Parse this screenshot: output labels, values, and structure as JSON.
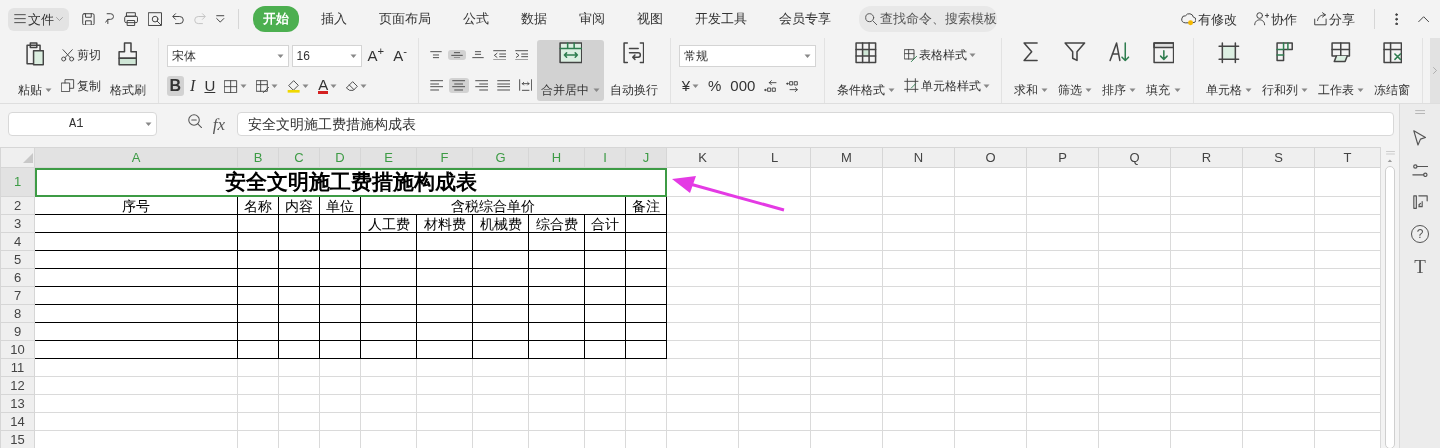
{
  "title_bar": {
    "file_menu": {
      "label": "文件"
    },
    "quick_access": [
      {
        "kind": "save",
        "disabled": false
      },
      {
        "kind": "hook",
        "disabled": false
      },
      {
        "kind": "print",
        "disabled": false
      },
      {
        "kind": "preview",
        "disabled": false
      },
      {
        "kind": "undo",
        "disabled": false
      },
      {
        "kind": "redo",
        "disabled": true
      },
      {
        "kind": "more",
        "disabled": false
      }
    ],
    "menu_tabs": [
      {
        "label": "开始",
        "selected": true
      },
      {
        "label": "插入",
        "selected": false
      },
      {
        "label": "页面布局",
        "selected": false
      },
      {
        "label": "公式",
        "selected": false
      },
      {
        "label": "数据",
        "selected": false
      },
      {
        "label": "审阅",
        "selected": false
      },
      {
        "label": "视图",
        "selected": false
      },
      {
        "label": "开发工具",
        "selected": false
      },
      {
        "label": "会员专享",
        "selected": false
      }
    ],
    "search": {
      "placeholder": "查找命令、搜索模板"
    },
    "actions": [
      {
        "kind": "cloud",
        "label": "有修改"
      },
      {
        "kind": "person",
        "label": "协作"
      },
      {
        "kind": "share",
        "label": "分享"
      }
    ]
  },
  "ribbon": [
    {
      "columns": [
        {
          "large": {
            "kind": "clipboard",
            "label": "粘贴",
            "dropdown": true
          }
        },
        {
          "lines": [
            {
              "items": [
                {
                  "kind": "scissors",
                  "label": "剪切"
                }
              ]
            },
            {
              "items": [
                {
                  "kind": "copy",
                  "label": "复制"
                }
              ]
            }
          ]
        },
        {
          "large": {
            "kind": "brush",
            "label": "格式刷"
          }
        }
      ]
    },
    {
      "columns": [
        {
          "lines": [
            {
              "items": [
                {
                  "kind": "font-select",
                  "value": "宋体"
                },
                {
                  "kind": "size-select",
                  "value": "16"
                },
                {
                  "kind": "text",
                  "label": "A$^{+}$"
                },
                {
                  "kind": "text",
                  "label": "A$^{-}$"
                }
              ]
            },
            {
              "items": [
                {
                  "kind": "bold",
                  "label": "B",
                  "selected": true
                },
                {
                  "kind": "italic",
                  "label": "I",
                  "selected": false
                },
                {
                  "kind": "underline",
                  "label": "U",
                  "selected": false
                },
                {
                  "kind": "borders",
                  "dropdown": true
                },
                {
                  "kind": "cell-style",
                  "dropdown": true
                },
                {
                  "kind": "fill",
                  "dropdown": true
                },
                {
                  "kind": "font-color",
                  "label": "A",
                  "dropdown": true
                },
                {
                  "kind": "eraser",
                  "dropdown": true
                }
              ]
            }
          ]
        }
      ]
    },
    {
      "columns": [
        {
          "lines": [
            {
              "items": [
                {
                  "kind": "align-top",
                  "selected": false
                },
                {
                  "kind": "align-middle",
                  "selected": true
                },
                {
                  "kind": "align-bottom",
                  "selected": false
                },
                {
                  "kind": "indent-less",
                  "selected": false
                },
                {
                  "kind": "indent-more",
                  "selected": false
                }
              ]
            },
            {
              "items": [
                {
                  "kind": "align-left",
                  "selected": false
                },
                {
                  "kind": "align-center",
                  "selected": true
                },
                {
                  "kind": "align-right",
                  "selected": false
                },
                {
                  "kind": "justify",
                  "selected": false
                },
                {
                  "kind": "distribute",
                  "selected": false
                }
              ]
            }
          ]
        },
        {
          "large": {
            "kind": "merge",
            "label": "合并居中",
            "dropdown": true,
            "selected": true
          }
        },
        {
          "large": {
            "kind": "wrap",
            "label": "自动换行",
            "selected": false
          }
        }
      ]
    },
    {
      "columns": [
        {
          "lines": [
            {
              "items": [
                {
                  "kind": "format-select",
                  "value": "常规"
                }
              ]
            },
            {
              "items": [
                {
                  "kind": "text",
                  "label": "¥",
                  "dropdown": true
                },
                {
                  "kind": "text",
                  "label": "%"
                },
                {
                  "kind": "text",
                  "label": "000"
                },
                {
                  "kind": "decimal-more"
                },
                {
                  "kind": "decimal-less"
                }
              ]
            }
          ]
        }
      ]
    },
    {
      "columns": [
        {
          "large": {
            "kind": "grid-cond",
            "label": "条件格式",
            "dropdown": true
          }
        },
        {
          "lines": [
            {
              "items": [
                {
                  "kind": "table-style",
                  "label": "表格样式",
                  "dropdown": true
                }
              ]
            },
            {
              "items": [
                {
                  "kind": "cell-format",
                  "label": "单元格样式",
                  "dropdown": true
                }
              ]
            }
          ]
        }
      ]
    },
    {
      "columns": [
        {
          "large": {
            "kind": "sum",
            "label": "求和",
            "dropdown": true
          }
        },
        {
          "large": {
            "kind": "filter",
            "label": "筛选",
            "dropdown": true
          }
        },
        {
          "large": {
            "kind": "sort",
            "label": "排序",
            "dropdown": true
          }
        },
        {
          "large": {
            "kind": "fill-down",
            "label": "填充",
            "dropdown": true
          }
        }
      ]
    },
    {
      "columns": [
        {
          "large": {
            "kind": "cells",
            "label": "单元格",
            "dropdown": true
          }
        },
        {
          "large": {
            "kind": "rows-cols",
            "label": "行和列",
            "dropdown": true
          }
        },
        {
          "large": {
            "kind": "sheet",
            "label": "工作表",
            "dropdown": true
          }
        },
        {
          "large": {
            "kind": "freeze",
            "label": "冻结窗"
          }
        }
      ]
    }
  ],
  "formula_bar": {
    "name_box": "A1",
    "function_label": "fx",
    "formula": "安全文明施工费措施构成表"
  },
  "sheet": {
    "columns": [
      {
        "label": "A",
        "selected": true
      },
      {
        "label": "B",
        "selected": true
      },
      {
        "label": "C",
        "selected": true
      },
      {
        "label": "D",
        "selected": true
      },
      {
        "label": "E",
        "selected": true
      },
      {
        "label": "F",
        "selected": true
      },
      {
        "label": "G",
        "selected": true
      },
      {
        "label": "H",
        "selected": true
      },
      {
        "label": "I",
        "selected": true
      },
      {
        "label": "J",
        "selected": true
      },
      {
        "label": "K",
        "selected": false
      },
      {
        "label": "L",
        "selected": false
      },
      {
        "label": "M",
        "selected": false
      },
      {
        "label": "N",
        "selected": false
      },
      {
        "label": "O",
        "selected": false
      },
      {
        "label": "P",
        "selected": false
      },
      {
        "label": "Q",
        "selected": false
      },
      {
        "label": "R",
        "selected": false
      },
      {
        "label": "S",
        "selected": false
      },
      {
        "label": "T",
        "selected": false
      }
    ],
    "rows": [
      {
        "label": "1",
        "selected": true,
        "cells": [
          {
            "text": "安全文明施工费措施构成表",
            "kind": "merged",
            "bold": true
          }
        ]
      },
      {
        "label": "2",
        "selected": false,
        "cells": [
          {
            "text": "序号"
          },
          {
            "text": "名称"
          },
          {
            "text": "内容"
          },
          {
            "text": "单位"
          },
          {
            "text": "含税综合单价",
            "kind": "merged"
          },
          {
            "text": "备注"
          }
        ]
      },
      {
        "label": "3",
        "selected": false,
        "cells": [
          {},
          {},
          {},
          {},
          {
            "text": "人工费"
          },
          {
            "text": "材料费"
          },
          {
            "text": "机械费"
          },
          {
            "text": "综合费"
          },
          {
            "text": "合计"
          },
          {}
        ]
      },
      {
        "label": "4",
        "selected": false,
        "cells": [
          {},
          {},
          {},
          {},
          {},
          {},
          {},
          {},
          {},
          {}
        ]
      },
      {
        "label": "5",
        "selected": false,
        "cells": [
          {},
          {},
          {},
          {},
          {},
          {},
          {},
          {},
          {},
          {}
        ]
      },
      {
        "label": "6",
        "selected": false,
        "cells": [
          {},
          {},
          {},
          {},
          {},
          {},
          {},
          {},
          {},
          {}
        ]
      },
      {
        "label": "7",
        "selected": false,
        "cells": [
          {},
          {},
          {},
          {},
          {},
          {},
          {},
          {},
          {},
          {}
        ]
      },
      {
        "label": "8",
        "selected": false,
        "cells": [
          {},
          {},
          {},
          {},
          {},
          {},
          {},
          {},
          {},
          {}
        ]
      },
      {
        "label": "9",
        "selected": false,
        "cells": [
          {},
          {},
          {},
          {},
          {},
          {},
          {},
          {},
          {},
          {}
        ]
      },
      {
        "label": "10",
        "selected": false,
        "cells": [
          {},
          {},
          {},
          {},
          {},
          {},
          {},
          {},
          {},
          {}
        ]
      },
      {
        "label": "11",
        "selected": false
      },
      {
        "label": "12",
        "selected": false
      },
      {
        "label": "13",
        "selected": false
      },
      {
        "label": "14",
        "selected": false
      },
      {
        "label": "15",
        "selected": false
      }
    ]
  },
  "side_panel": [
    {
      "kind": "pointer"
    },
    {
      "kind": "sliders"
    },
    {
      "kind": "swap"
    },
    {
      "kind": "help",
      "label": "?"
    },
    {
      "kind": "text",
      "label": "T"
    }
  ]
}
